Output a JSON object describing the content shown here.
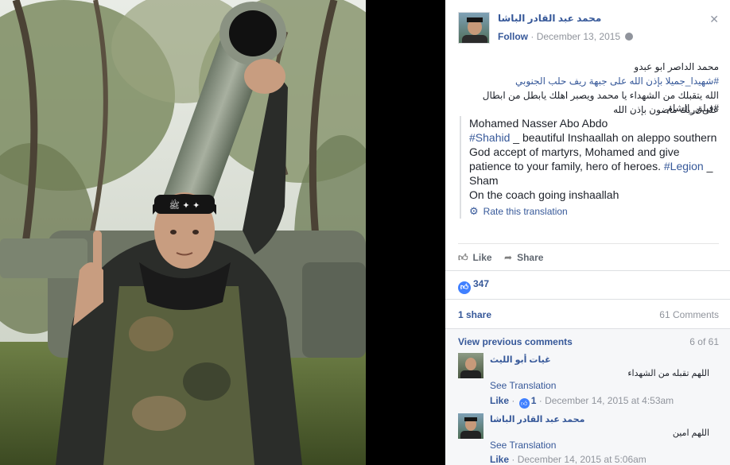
{
  "photo": {
    "alt": ""
  },
  "post": {
    "author": "محمد عبد القادر الباشا",
    "follow": "Follow",
    "separator": "·",
    "date": "December 13, 2015",
    "arabic_lines": [
      "محمد الداصر ابو عبدو",
      "#شهيدا_جميلا بإذن الله على جبهة ريف حلب الجنوبي",
      "الله يتقبلك من الشهداء يا محمد ويصبر اهلك يابطل من ابطال #فيلق_الشام",
      "على دربك ماضون بإذن الله"
    ],
    "translation": {
      "line1": "Mohamed Nasser Abo Abdo",
      "line2_tag": "#Shahid",
      "line2_rest": " _ beautiful Inshaallah on aleppo southern",
      "line3": "God accept of martyrs, Mohamed and give",
      "line4_pre": "patience to your family, hero of heroes. ",
      "line4_tag": "#Legion",
      "line4_rest": " _",
      "line5": "Sham",
      "line6": "On the coach going inshaallah",
      "rate": "Rate this translation"
    }
  },
  "actions": {
    "like": "Like",
    "share": "Share"
  },
  "stats": {
    "likes": "347",
    "shares": "1 share",
    "comments": "61 Comments",
    "view_previous": "View previous comments",
    "paging": "6 of 61"
  },
  "comments": [
    {
      "author": "غيات أبو الليث",
      "text": "اللهم تقبله من الشهداء",
      "see_translation": "See Translation",
      "like": "Like",
      "sep": "·",
      "like_count": "1",
      "time": "December 14, 2015 at 4:53am"
    },
    {
      "author": "محمد عبد القادر الباشا",
      "text": "اللهم امين",
      "see_translation": "See Translation",
      "like": "Like",
      "sep": "·",
      "time": "December 14, 2015 at 5:06am"
    }
  ],
  "colors": {
    "link": "#365899",
    "muted": "#90949c",
    "like_blue": "#4080ff"
  },
  "icons": [
    "close-icon",
    "globe-icon",
    "like-icon",
    "share-icon",
    "gear-icon",
    "like-reaction-icon"
  ]
}
